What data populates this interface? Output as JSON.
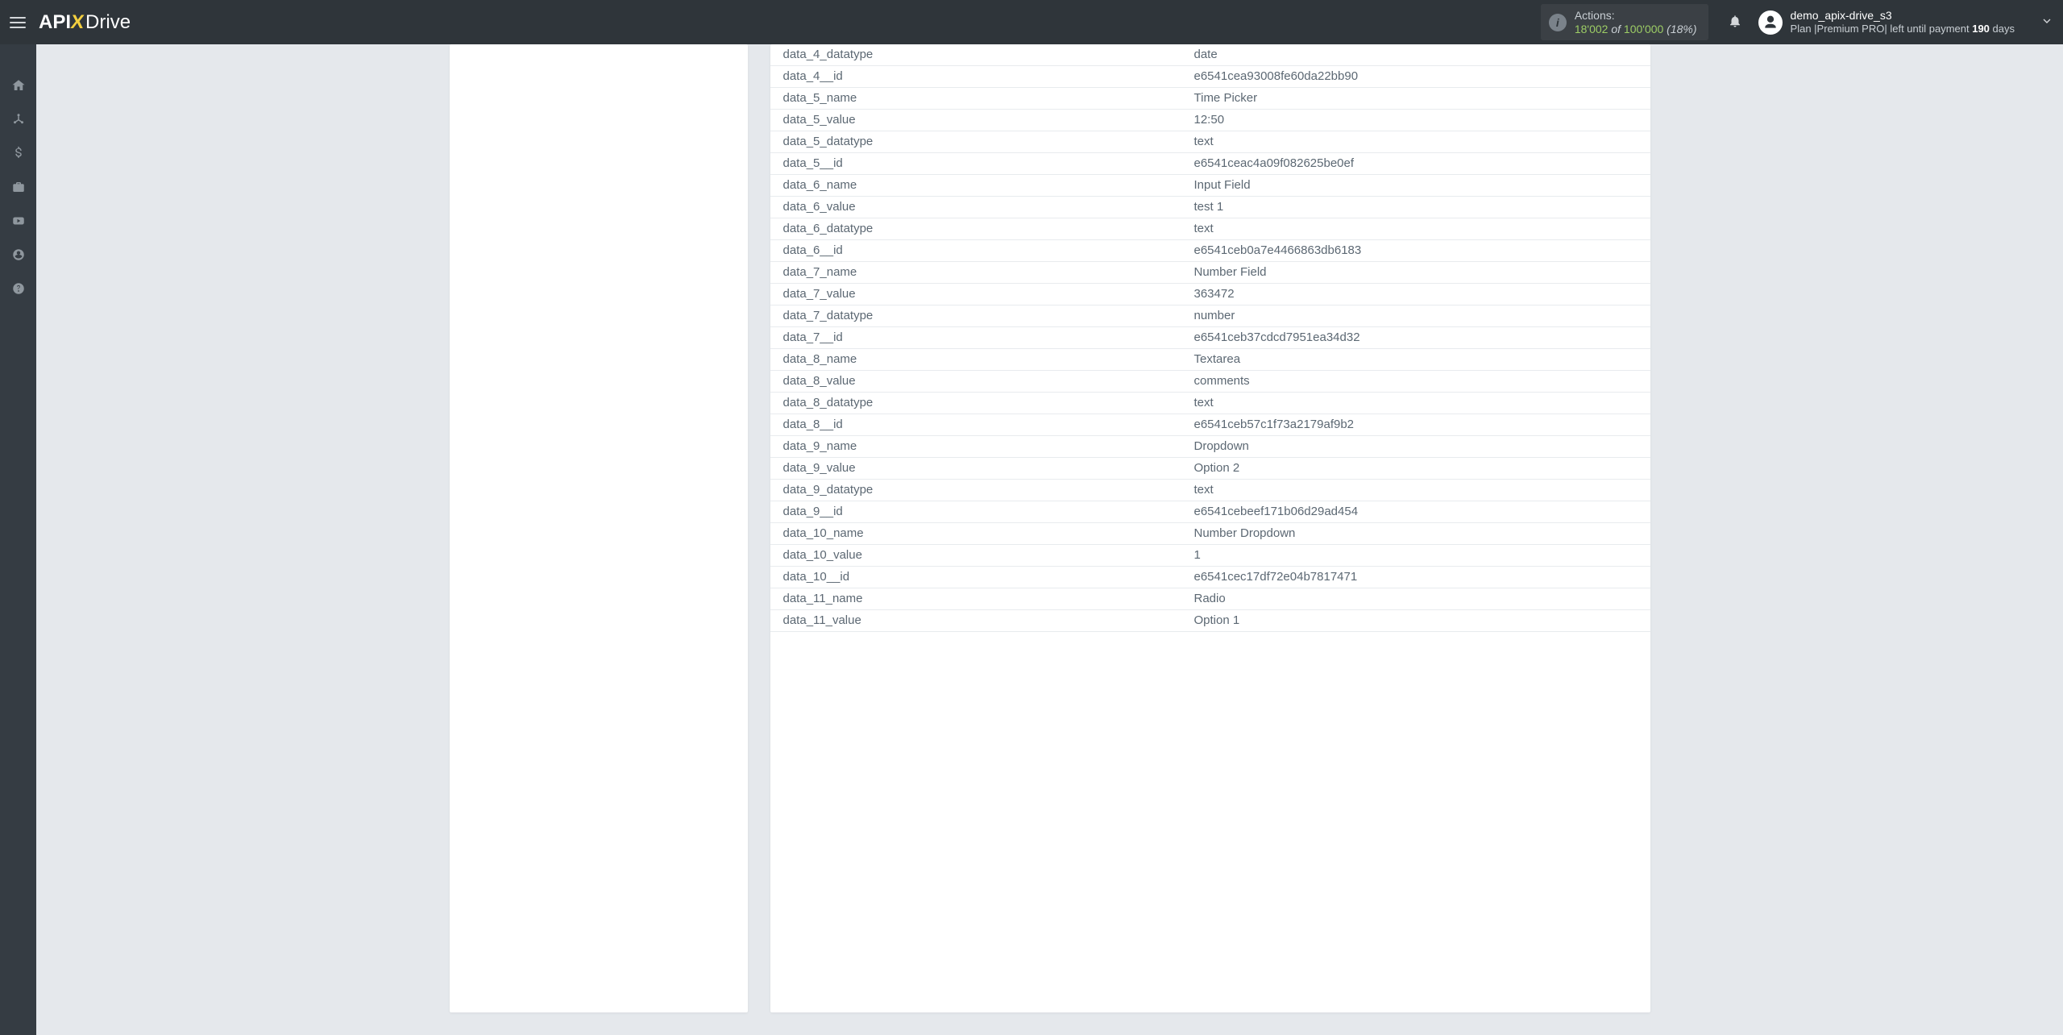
{
  "header": {
    "logo_api": "API",
    "logo_x": "X",
    "logo_drive": "Drive",
    "actions_label": "Actions:",
    "actions_used": "18'002",
    "actions_of": " of ",
    "actions_total": "100'000",
    "actions_pct": " (18%)",
    "user_name": "demo_apix-drive_s3",
    "plan_prefix": "Plan |",
    "plan_name": "Premium PRO",
    "plan_mid": "| left until payment ",
    "plan_days_num": "190",
    "plan_days_suffix": " days"
  },
  "rows": [
    {
      "key": "data_4_datatype",
      "val": "date"
    },
    {
      "key": "data_4__id",
      "val": "e6541cea93008fe60da22bb90"
    },
    {
      "key": "data_5_name",
      "val": "Time Picker"
    },
    {
      "key": "data_5_value",
      "val": "12:50"
    },
    {
      "key": "data_5_datatype",
      "val": "text"
    },
    {
      "key": "data_5__id",
      "val": "e6541ceac4a09f082625be0ef"
    },
    {
      "key": "data_6_name",
      "val": "Input Field"
    },
    {
      "key": "data_6_value",
      "val": "test 1"
    },
    {
      "key": "data_6_datatype",
      "val": "text"
    },
    {
      "key": "data_6__id",
      "val": "e6541ceb0a7e4466863db6183"
    },
    {
      "key": "data_7_name",
      "val": "Number Field"
    },
    {
      "key": "data_7_value",
      "val": "363472"
    },
    {
      "key": "data_7_datatype",
      "val": "number"
    },
    {
      "key": "data_7__id",
      "val": "e6541ceb37cdcd7951ea34d32"
    },
    {
      "key": "data_8_name",
      "val": "Textarea"
    },
    {
      "key": "data_8_value",
      "val": "comments"
    },
    {
      "key": "data_8_datatype",
      "val": "text"
    },
    {
      "key": "data_8__id",
      "val": "e6541ceb57c1f73a2179af9b2"
    },
    {
      "key": "data_9_name",
      "val": "Dropdown"
    },
    {
      "key": "data_9_value",
      "val": "Option 2"
    },
    {
      "key": "data_9_datatype",
      "val": "text"
    },
    {
      "key": "data_9__id",
      "val": "e6541cebeef171b06d29ad454"
    },
    {
      "key": "data_10_name",
      "val": "Number Dropdown"
    },
    {
      "key": "data_10_value",
      "val": "1"
    },
    {
      "key": "data_10__id",
      "val": "e6541cec17df72e04b7817471"
    },
    {
      "key": "data_11_name",
      "val": "Radio"
    },
    {
      "key": "data_11_value",
      "val": "Option 1"
    }
  ]
}
